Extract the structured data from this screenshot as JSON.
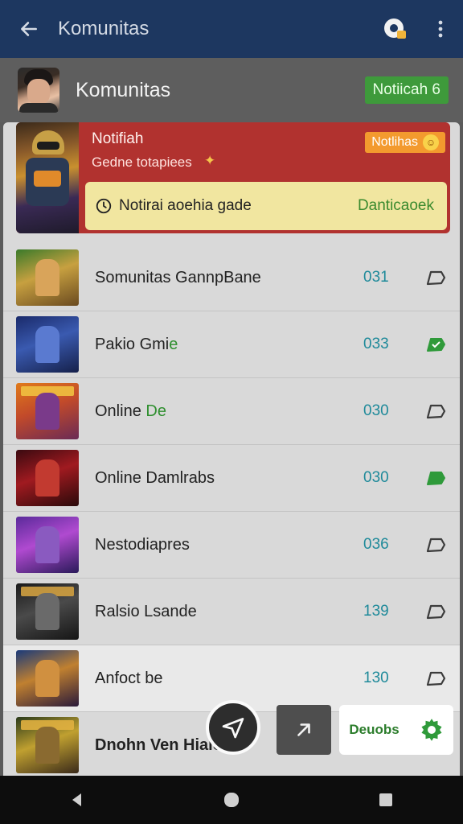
{
  "appbar": {
    "title": "Komunitas",
    "back_icon": "arrow-left-icon",
    "badge_icon": "notification-badge-icon",
    "more_icon": "more-vertical-icon"
  },
  "community": {
    "name": "Komunitas",
    "notif_label": "Notiicah 6"
  },
  "hero": {
    "title": "Notifiah",
    "subtitle": "Gedne totapiees",
    "pill_label": "Notlihas",
    "alert_message": "Notirai aoehia gade",
    "alert_action": "Danticaoek"
  },
  "rows": [
    {
      "label": "Somunitas GannpBane",
      "label_green": "",
      "count": "031",
      "tag_active": false
    },
    {
      "label": "Pakio Gmi",
      "label_green": "e",
      "count": "033",
      "tag_active": true
    },
    {
      "label": "Online ",
      "label_green": "De",
      "count": "030",
      "tag_active": false
    },
    {
      "label": "Online Damlrabs",
      "label_green": "",
      "count": "030",
      "tag_active": true
    },
    {
      "label": "Nestodiapres",
      "label_green": "",
      "count": "036",
      "tag_active": false
    },
    {
      "label": "Ralsio Lsande",
      "label_green": "",
      "count": "139",
      "tag_active": false
    },
    {
      "label": "Anfoct be",
      "label_green": "",
      "count": "130",
      "tag_active": false
    },
    {
      "label": "Dnohn Ven Hiaio",
      "label_green": "",
      "count": "",
      "tag_active": false
    }
  ],
  "bottom": {
    "cta_label": "Deuobs"
  },
  "colors": {
    "appbar": "#1d3760",
    "hero": "#b1322f",
    "alert": "#f1e6a0",
    "accent_green": "#3e9a3b",
    "count_teal": "#1f8a9a"
  }
}
